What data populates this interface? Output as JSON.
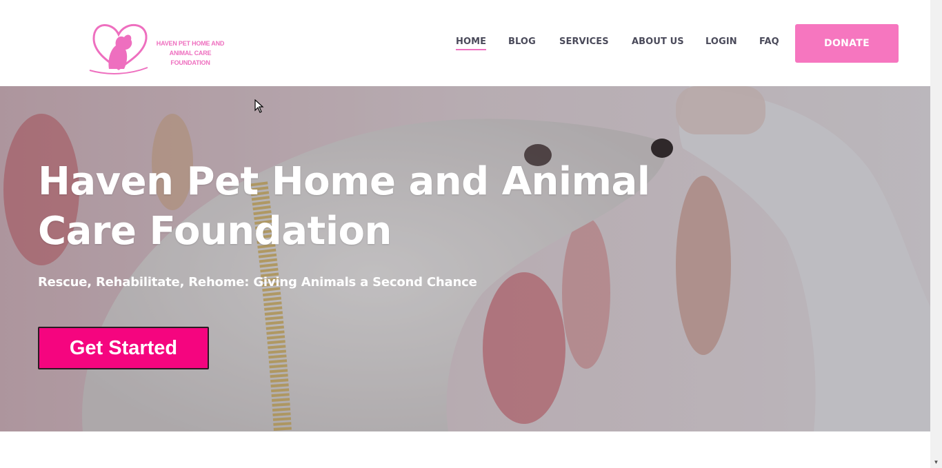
{
  "header": {
    "logo_text": "HAVEN PET HOME AND ANIMAL CARE FOUNDATION",
    "nav": [
      {
        "label": "HOME",
        "active": true
      },
      {
        "label": "BLOG"
      },
      {
        "label": "SERVICES"
      },
      {
        "label": "ABOUT US"
      },
      {
        "label": "LOGIN"
      },
      {
        "label": "FAQ"
      }
    ],
    "donate_label": "DONATE"
  },
  "hero": {
    "title": "Haven Pet Home and Animal Care Foundation",
    "subtitle": "Rescue, Rehabilitate, Rehome: Giving Animals a Second Chance",
    "cta_label": "Get Started"
  },
  "colors": {
    "brand_pink": "#ee6fbf",
    "donate_bg": "#f676bf",
    "cta_bg": "#f5057f"
  },
  "icons": {
    "logo": "heart-pet-logo",
    "cursor": "mouse-pointer-icon",
    "scroll": "chevron-down-icon"
  }
}
